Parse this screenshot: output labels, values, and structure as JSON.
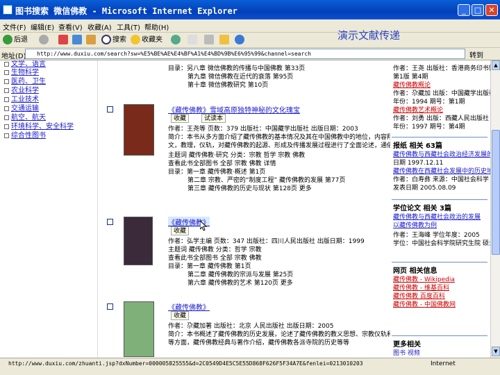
{
  "window": {
    "title": "图书搜索 微信佛教 - Microsoft Internet Explorer",
    "minimize": "_",
    "maximize": "□",
    "close": "✕"
  },
  "menu": [
    "文件(F)",
    "编辑(E)",
    "查看(V)",
    "收藏(A)",
    "工具(T)",
    "帮助(H)"
  ],
  "overlay_text": "演示文献传递",
  "toolbar": {
    "back": "后退",
    "search": "搜索",
    "favorites": "收藏夹"
  },
  "address": {
    "label": "地址(D)",
    "url": "http://www.duxiu.com/search?sw=%E5%BE%AE%E4%BF%A1%E4%BD%9B%E6%95%99&channel=search",
    "go": "转到"
  },
  "sidebar": {
    "categories": [
      "文学、语言",
      "生物科学",
      "医药、卫生",
      "农业科学",
      "工业技术",
      "交通运输",
      "航空、航天",
      "环境科学、安全科学",
      "综合性图书"
    ]
  },
  "results": [
    {
      "lines_top": [
        "目录：另八章 微信佛教的传播与中国佛教 第33页",
        "第九章 微信佛教在近代的衰落 第95页",
        "第十章 微信佛教研究 第10页"
      ]
    },
    {
      "title": "《藏传佛教》雪域高原独特神秘的文化瑰宝",
      "collect": "收藏",
      "preview": "试读本",
      "lines": [
        "作者：王尧等 页数：379 出版社：中国藏学出版社 出版日期：2003",
        "简介：本书从多方面介绍了藏传佛教的基本情况及其在中国佛教中的地位，内容翔实",
        "文，教理，仪轨，对藏传佛教的起源、形成及传播发展过程进行了全面论述，通俗易懂",
        "主题词 藏传佛教·研究 分类：宗教 哲学 宗教 佛教",
        "查看此书全部图书 全部 宗教 佛教 详情",
        "目录：第一章 藏传佛教·概述 第1页",
        "第二章 宗教、严密的“制度工程” 藏传佛教的发展 第77页",
        "第三章 藏传佛教的历史与现状 第128页 更多"
      ],
      "cover_color": "#7a2a1a"
    },
    {
      "title": "《藏传佛教》",
      "collect": "收藏",
      "lines": [
        "作者：弘学主编 页数：347 出版社：四川人民出版社 出版日期：1999",
        "主题词 藏传佛教 分类：哲学 宗教",
        "查看此书全部图书 全部 宗教 佛教",
        "目录：第一章 藏传佛教 第1页",
        "第二章 藏传佛教的宗派与发展 第25页",
        "第六章 藏传佛教的艺术 第120页 更多"
      ],
      "cover_color": "#3a2a3a"
    },
    {
      "title": "《藏传佛教》",
      "collect": "收藏",
      "lines": [
        "作者：尕藏加著 出版社：北京 人民出版社 出版日期：2005",
        "简介：本书概述了藏传佛教的历史发展，论述了藏传佛教的教义思想、宗教仪轨和文化艺术",
        "等方面，藏传佛教经典与著作介绍，藏传佛教各派寺院的历史等等"
      ],
      "cover_color": "#7fb07a"
    }
  ],
  "rightcol": {
    "top_lines": [
      "作者：王尧 出版社：香港商务印书馆 1999年",
      "第1版 第4期",
      "藏传佛教概论",
      "作者：尕藏加 出版：中国藏学出版社",
      "年份：1994 期号：第1期",
      "藏传佛教艺术概论",
      "作者：刘勇 出版：西藏人民出版社",
      "年份：1997 期号：第4期"
    ],
    "sections": [
      {
        "head": "报纸 相关 63篇",
        "lines": [
          "藏传佛教与西藏社会政治经济发展的关系",
          "日期 1997.12.11",
          "藏传佛教在西藏社会发展中的历史地位作用",
          "作者：白寿彝 来源：中国社会科学",
          "发表日期 2005.08.09"
        ]
      },
      {
        "head": "学位论文 相关 3篇",
        "lines": [
          "藏传佛教与西藏社会政治的发展",
          "以藏传佛教为例",
          "作者：王海峰 学位年度：2005",
          "学位：中国社会科学院研究生院 硕士论文"
        ]
      },
      {
        "head": "网页 相关信息",
        "lines": [
          "藏传佛教 - Wikipedia",
          "藏传佛教 - 维基百科",
          "藏传佛教 百度百科",
          "藏传佛教 - 中国佛教网"
        ]
      },
      {
        "head": "更多相关",
        "lines": [
          "图书 视频"
        ]
      }
    ]
  },
  "status": {
    "url": "http://www.duxiu.com/zhuanti.jsp?dxNumber=000005825555&d=2C0549D4E5C5E55D868F626F5F34A7E&fenlei=0213010203",
    "zone": "Internet"
  }
}
